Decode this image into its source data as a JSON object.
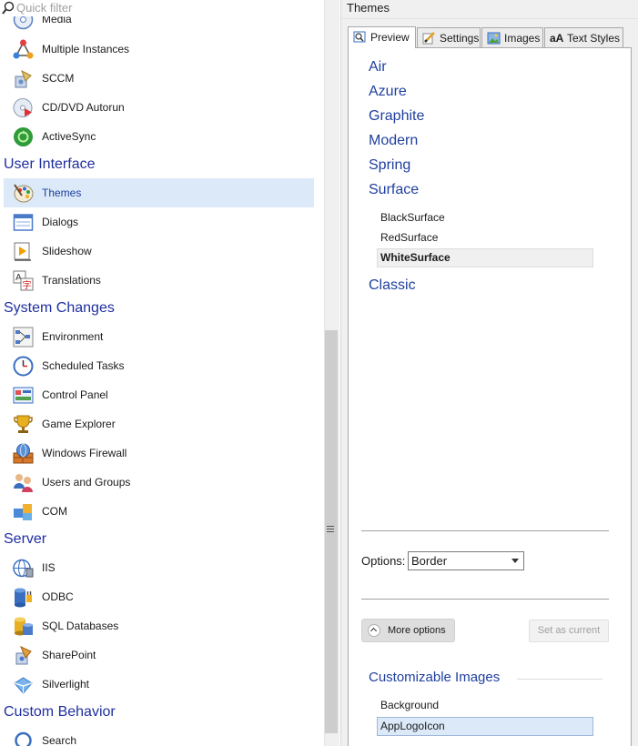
{
  "filter": {
    "placeholder": "Quick filter"
  },
  "left_panel": {
    "items": [
      {
        "label": "Media",
        "icon": "media-icon"
      },
      {
        "label": "Multiple Instances",
        "icon": "multiple-instances-icon"
      },
      {
        "label": "SCCM",
        "icon": "sccm-icon"
      },
      {
        "label": "CD/DVD Autorun",
        "icon": "cd-dvd-autorun-icon"
      },
      {
        "label": "ActiveSync",
        "icon": "activesync-icon"
      }
    ],
    "groups": [
      {
        "title": "User Interface",
        "items": [
          {
            "label": "Themes",
            "icon": "themes-icon",
            "selected": true
          },
          {
            "label": "Dialogs",
            "icon": "dialogs-icon"
          },
          {
            "label": "Slideshow",
            "icon": "slideshow-icon"
          },
          {
            "label": "Translations",
            "icon": "translations-icon"
          }
        ]
      },
      {
        "title": "System Changes",
        "items": [
          {
            "label": "Environment",
            "icon": "environment-icon"
          },
          {
            "label": "Scheduled Tasks",
            "icon": "scheduled-tasks-icon"
          },
          {
            "label": "Control Panel",
            "icon": "control-panel-icon"
          },
          {
            "label": "Game Explorer",
            "icon": "game-explorer-icon"
          },
          {
            "label": "Windows Firewall",
            "icon": "windows-firewall-icon"
          },
          {
            "label": "Users and Groups",
            "icon": "users-and-groups-icon"
          },
          {
            "label": "COM",
            "icon": "com-icon"
          }
        ]
      },
      {
        "title": "Server",
        "items": [
          {
            "label": "IIS",
            "icon": "iis-icon"
          },
          {
            "label": "ODBC",
            "icon": "odbc-icon"
          },
          {
            "label": "SQL Databases",
            "icon": "sql-databases-icon"
          },
          {
            "label": "SharePoint",
            "icon": "sharepoint-icon"
          },
          {
            "label": "Silverlight",
            "icon": "silverlight-icon"
          }
        ]
      },
      {
        "title": "Custom Behavior",
        "items": [
          {
            "label": "Search",
            "icon": "search-icon"
          }
        ]
      }
    ]
  },
  "right_panel": {
    "title": "Themes",
    "tabs": [
      {
        "label": "Preview",
        "icon": "preview-icon",
        "active": true
      },
      {
        "label": "Settings",
        "icon": "settings-icon"
      },
      {
        "label": "Images",
        "icon": "images-icon"
      },
      {
        "label": "Text Styles",
        "icon": "text-styles-icon"
      }
    ],
    "themes": [
      "Air",
      "Azure",
      "Graphite",
      "Modern",
      "Spring",
      "Surface",
      "Classic"
    ],
    "surface_variants": [
      "BlackSurface",
      "RedSurface",
      "WhiteSurface"
    ],
    "selected_variant": "WhiteSurface",
    "options": {
      "label": "Options:",
      "value": "Border"
    },
    "buttons": {
      "more_options": "More options",
      "set_as_current": "Set as current"
    },
    "customizable_images": {
      "title": "Customizable Images",
      "items": [
        "Background",
        "AppLogoIcon"
      ],
      "selected": "AppLogoIcon"
    }
  },
  "colors": {
    "accent_text": "#1f3f9f",
    "selection": "#dbe9f8",
    "panel_bg": "#f0f0f0"
  }
}
